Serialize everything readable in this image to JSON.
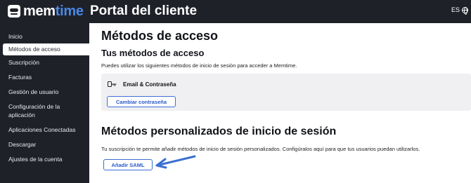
{
  "brand": {
    "name_part1": "mem",
    "name_part2": "time"
  },
  "header": {
    "title": "Portal del cliente",
    "language": "ES"
  },
  "sidebar": {
    "items": [
      {
        "label": "Inicio"
      },
      {
        "label": "Métodos de acceso",
        "active": true
      },
      {
        "label": "Suscripción"
      },
      {
        "label": "Facturas"
      },
      {
        "label": "Gestión de usuario"
      },
      {
        "label": "Configuración de la"
      },
      {
        "label": "aplicación"
      },
      {
        "label": "Aplicaciones Conectadas"
      },
      {
        "label": "Descargar"
      },
      {
        "label": "Ajustes de la cuenta"
      }
    ]
  },
  "main": {
    "title": "Métodos de acceso",
    "your_methods": {
      "heading": "Tus métodos de acceso",
      "description": "Puedes utilizar los siguientes métodos de inicio de sesión para acceder a Memtime.",
      "method_label": "Email & Contraseña",
      "change_password_label": "Cambiar contraseña"
    },
    "custom_methods": {
      "heading": "Métodos personalizados de inicio de sesión",
      "description": "Tu suscripción te permite añadir métodos de inicio de sesión personalizados. Configúralos aquí para que tus usuarios puedan utilizarlos.",
      "add_saml_label": "Añadir SAML"
    }
  },
  "colors": {
    "dark_bg": "#1f2129",
    "accent_blue": "#3b6fd4",
    "brand_blue": "#4a87e6"
  },
  "icons": [
    "memtime-logo-icon",
    "globe-icon",
    "key-icon",
    "arrow-annotation-icon"
  ]
}
